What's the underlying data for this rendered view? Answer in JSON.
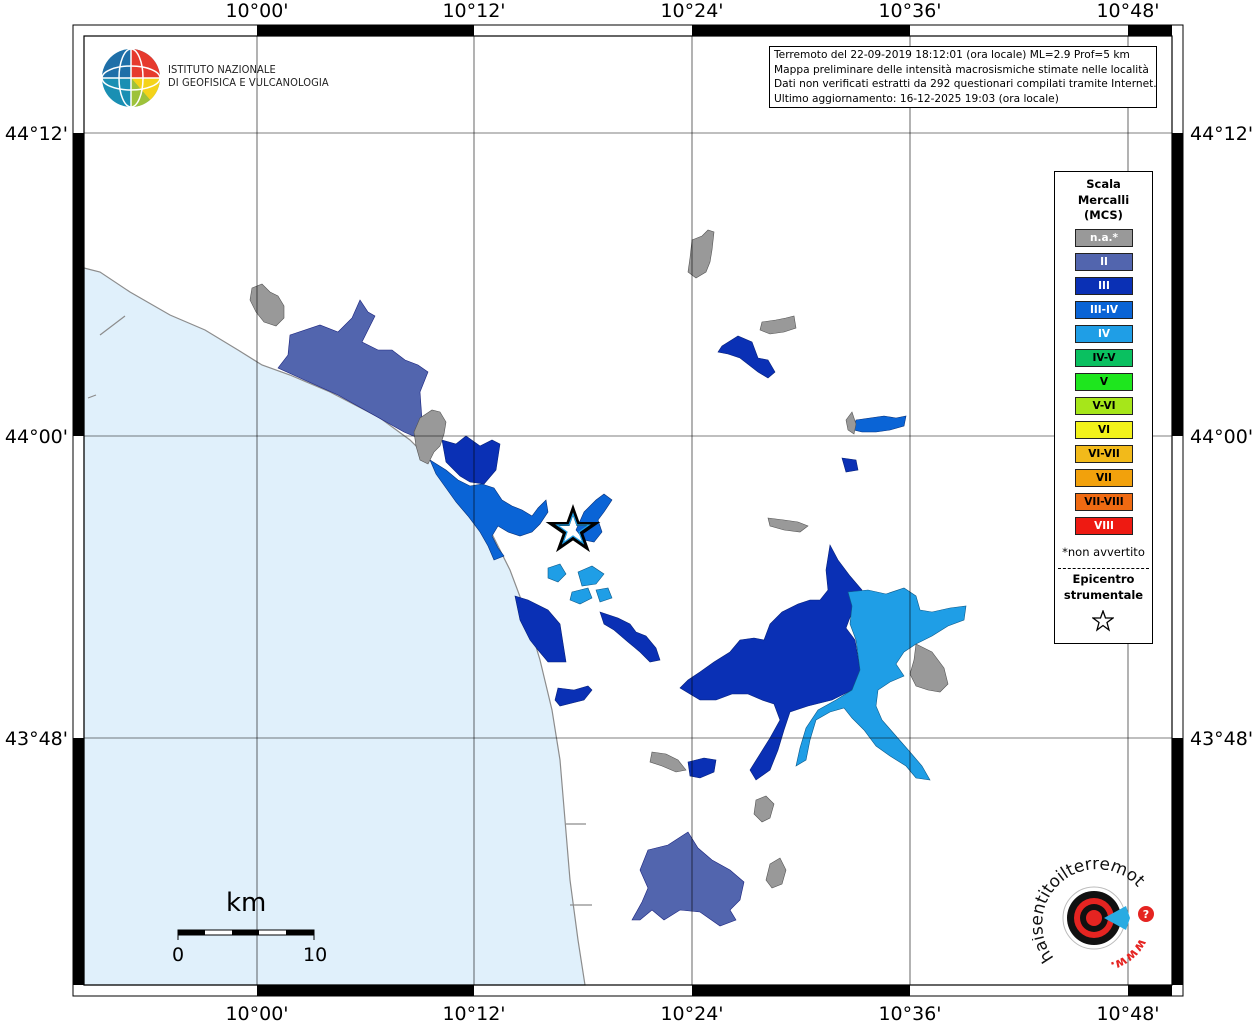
{
  "map": {
    "lon_labels": [
      "10°00'",
      "10°12'",
      "10°24'",
      "10°36'",
      "10°48'"
    ],
    "lat_labels": [
      "44°12'",
      "44°00'",
      "43°48'"
    ]
  },
  "logo": {
    "line1": "ISTITUTO NAZIONALE",
    "line2": "DI GEOFISICA E VULCANOLOGIA"
  },
  "info": {
    "line1": "Terremoto del 22-09-2019 18:12:01 (ora locale) ML=2.9 Prof=5 km",
    "line2": "Mappa preliminare delle intensità macrosismiche stimate nelle località",
    "line3": "Dati non verificati estratti da 292 questionari compilati tramite Internet.",
    "line4": "Ultimo aggiornamento: 16-12-2025 19:03 (ora locale)"
  },
  "legend": {
    "title1": "Scala",
    "title2": "Mercalli",
    "title3": "(MCS)",
    "items": [
      {
        "label": "n.a.*",
        "color": "#999999",
        "text_color": "#ffffff"
      },
      {
        "label": "II",
        "color": "#5265ae",
        "text_color": "#ffffff"
      },
      {
        "label": "III",
        "color": "#0a30b5",
        "text_color": "#ffffff"
      },
      {
        "label": "III-IV",
        "color": "#0a64d6",
        "text_color": "#ffffff"
      },
      {
        "label": "IV",
        "color": "#1f9ee6",
        "text_color": "#ffffff"
      },
      {
        "label": "IV-V",
        "color": "#0ac060",
        "text_color": "#000000"
      },
      {
        "label": "V",
        "color": "#1ee61e",
        "text_color": "#000000"
      },
      {
        "label": "V-VI",
        "color": "#a6e61a",
        "text_color": "#000000"
      },
      {
        "label": "VI",
        "color": "#f2f21a",
        "text_color": "#000000"
      },
      {
        "label": "VI-VII",
        "color": "#f2ba1a",
        "text_color": "#000000"
      },
      {
        "label": "VII",
        "color": "#f2a10c",
        "text_color": "#000000"
      },
      {
        "label": "VII-VIII",
        "color": "#ef6a12",
        "text_color": "#000000"
      },
      {
        "label": "VIII",
        "color": "#ee1a12",
        "text_color": "#ffffff"
      }
    ],
    "note": "*non avvertito",
    "epi1": "Epicentro",
    "epi2": "strumentale"
  },
  "scale": {
    "unit": "km",
    "start": "0",
    "end": "10"
  },
  "hsit_logo": {
    "text": "haisentitoilterremoto.it",
    "www": "www.",
    "q": "?"
  },
  "colors": {
    "sea": "#e0f0fb",
    "coast": "#8c8c8c"
  }
}
